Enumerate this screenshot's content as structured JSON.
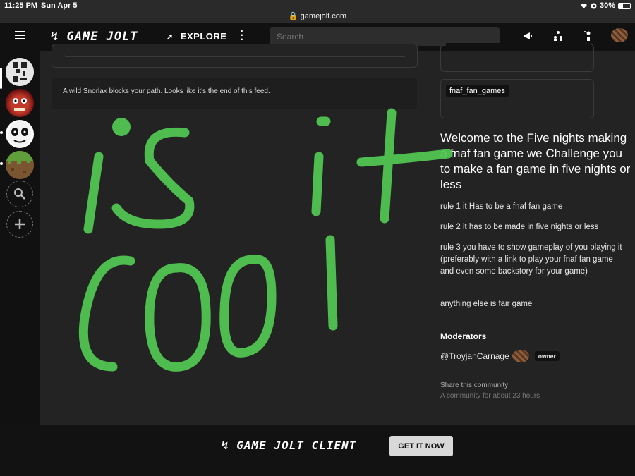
{
  "status_bar": {
    "time": "11:25 PM",
    "date": "Sun Apr 5",
    "battery": "30%"
  },
  "url_bar": {
    "domain": "gamejolt.com"
  },
  "topnav": {
    "logo": "GAME JOLT",
    "explore_label": "EXPLORE",
    "search_placeholder": "Search",
    "icons": [
      "menu-icon",
      "explore-icon",
      "more-icon",
      "megaphone-icon",
      "friends-icon",
      "activity-icon"
    ]
  },
  "sidebar": {
    "communities": [
      "qr-community",
      "fnaf-community",
      "clown-community",
      "minecraft-community"
    ],
    "actions": [
      "search-icon",
      "add-icon"
    ]
  },
  "feed": {
    "end_message": "A wild Snorlax blocks your path. Looks like it's the end of this feed."
  },
  "community": {
    "tag": "fnaf_fan_games",
    "description": "Welcome to the Five nights making a fnaf fan game we Challenge you to make a fan game in five nights or less",
    "rules": [
      "rule 1 it Has to be a fnaf fan game",
      "rule 2 it has to be made in five nights or less",
      "rule 3 you have to show gameplay of you playing it (preferably with a link to play your fnaf fan game and even some backstory for your game)",
      "anything else is fair game"
    ],
    "moderators_heading": "Moderators",
    "moderator": {
      "name": "@TroyjanCarnage",
      "badge": "owner"
    },
    "share_label": "Share this community",
    "age_label": "A community for about 23 hours"
  },
  "drawing_overlay": {
    "text": "is it cool",
    "color": "#5ad65a"
  },
  "bottom_banner": {
    "logo": "GAME JOLT CLIENT",
    "button_label": "GET IT NOW"
  }
}
